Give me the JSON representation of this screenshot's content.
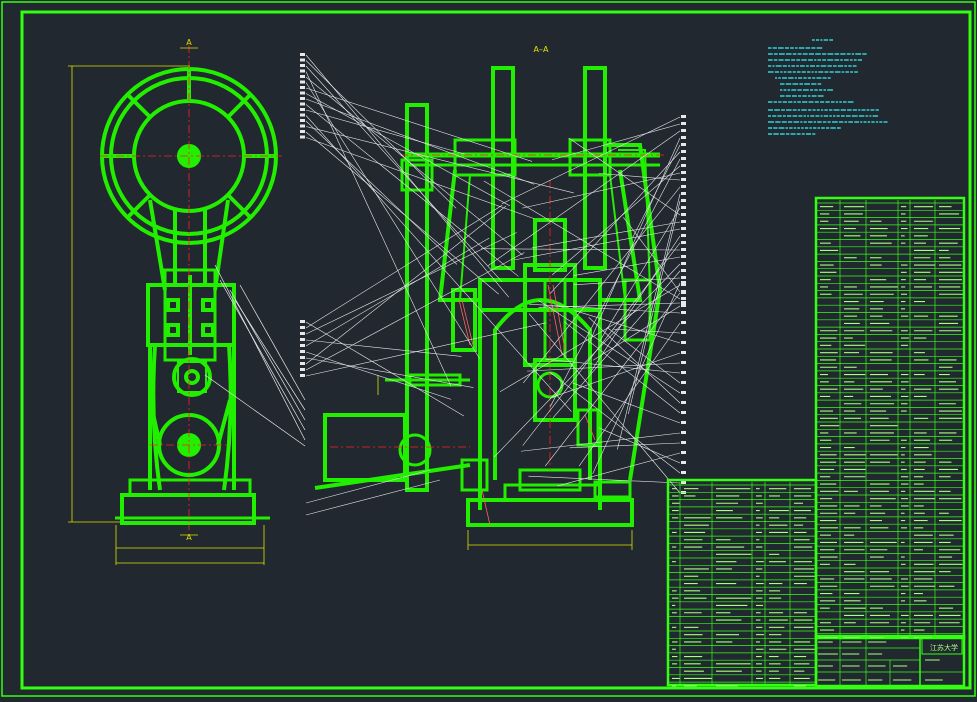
{
  "colors": {
    "background": "#212830",
    "frame": "#33ff11",
    "part": "#22ee00",
    "leader": "#e8e8e8",
    "centerline": "#ff2020",
    "dimension": "#e0e000",
    "note_text": "#33ffff",
    "table_text": "#a8ff80"
  },
  "views": {
    "front_label": "A",
    "front_bottom_label": "A",
    "section_label": "A–A"
  },
  "title_block": {
    "school": "江苏大学"
  }
}
